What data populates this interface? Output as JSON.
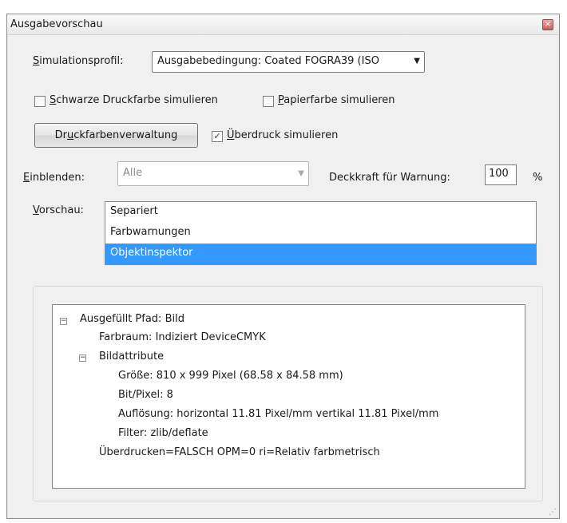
{
  "window": {
    "title": "Ausgabevorschau",
    "close_symbol": "×"
  },
  "simulation": {
    "label_prefix": "S",
    "label_rest": "imulationsprofil:",
    "profile_value": "Ausgabebedingung: Coated FOGRA39 (ISO"
  },
  "checkboxes": {
    "black_ink": {
      "label_underlined": "S",
      "label_rest": "chwarze Druckfarbe simulieren",
      "checked": false
    },
    "paper_color": {
      "label_underlined": "P",
      "label_rest": "apierfarbe simulieren",
      "checked": false
    },
    "overprint": {
      "label_underlined": "Ü",
      "label_rest": "berdruck simulieren",
      "checked": true,
      "check_mark": "✓"
    }
  },
  "ink_manager_button": {
    "label_before": "Dr",
    "label_underlined": "u",
    "label_after": "ckfarbenverwaltung"
  },
  "show": {
    "label_underlined": "E",
    "label_rest": "inblenden:",
    "value": "Alle"
  },
  "warning_opacity": {
    "label": "Deckkraft für Warnung:",
    "value": "100",
    "unit": "%"
  },
  "preview": {
    "label_underlined": "V",
    "label_rest": "orschau:",
    "options": [
      "Separiert",
      "Farbwarnungen",
      "Objektinspektor"
    ],
    "selected_index": 2
  },
  "object_tree": {
    "root": "Ausgefüllt Pfad: Bild",
    "color_space": "Farbraum: Indiziert DeviceCMYK",
    "image_attributes": "Bildattribute",
    "size": "Größe: 810 x 999 Pixel (68.58 x 84.58 mm)",
    "bits": "Bit/Pixel: 8",
    "resolution": "Auflösung: horizontal 11.81 Pixel/mm vertikal 11.81 Pixel/mm",
    "filter": "Filter: zlib/deflate",
    "overprint_info": "Überdrucken=FALSCH OPM=0 ri=Relativ farbmetrisch",
    "collapse_symbol": "−"
  },
  "colors": {
    "selection": "#3399ff",
    "dialog_bg": "#f0f0f0"
  }
}
